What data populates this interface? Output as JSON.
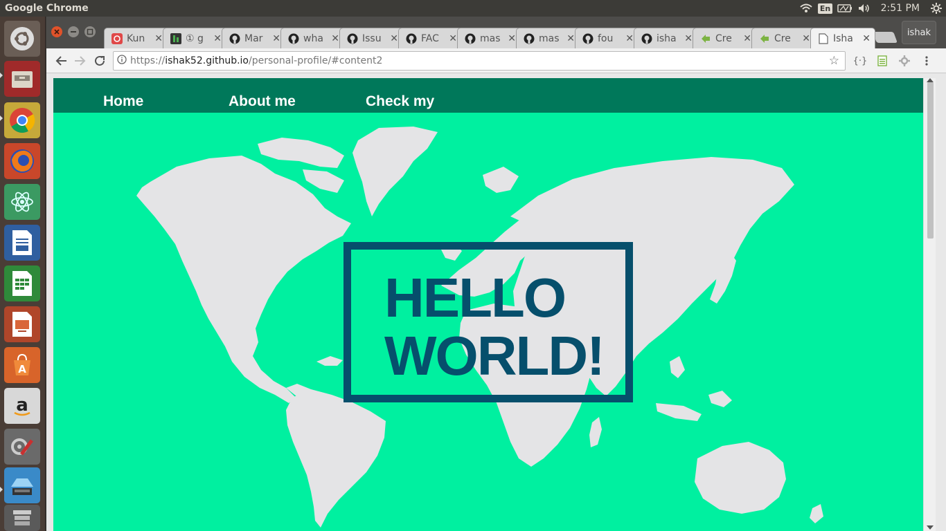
{
  "system": {
    "app_title": "Google Chrome",
    "keyboard_lang": "En",
    "clock": "2:51 PM"
  },
  "launcher": {
    "apps": [
      "ubuntu-dash",
      "files",
      "chrome",
      "firefox",
      "atom",
      "libreoffice-writer",
      "libreoffice-calc",
      "libreoffice-impress",
      "software-center",
      "amazon",
      "system-settings",
      "workspace-switcher",
      "trash"
    ]
  },
  "browser": {
    "tabs": [
      {
        "label": "Kun",
        "icon": "red-logo-icon"
      },
      {
        "label": "① g",
        "icon": "green-square-icon"
      },
      {
        "label": "Mar",
        "icon": "github-icon"
      },
      {
        "label": "wha",
        "icon": "github-icon"
      },
      {
        "label": "Issu",
        "icon": "github-icon"
      },
      {
        "label": "FAC",
        "icon": "github-icon"
      },
      {
        "label": "mas",
        "icon": "github-icon"
      },
      {
        "label": "mas",
        "icon": "github-icon"
      },
      {
        "label": "fou",
        "icon": "github-icon"
      },
      {
        "label": "isha",
        "icon": "github-icon"
      },
      {
        "label": "Cre",
        "icon": "green-arrow-icon"
      },
      {
        "label": "Cre",
        "icon": "green-arrow-icon"
      },
      {
        "label": "Isha",
        "icon": "document-icon",
        "active": true
      }
    ],
    "profile_name": "ishak",
    "url": {
      "scheme": "https://",
      "host": "ishak52.github.io",
      "path": "/personal-profile/#content2"
    }
  },
  "page": {
    "nav": [
      "Home",
      "About me",
      "Check my"
    ],
    "hero_text": "HELLO\nWORLD!"
  },
  "colors": {
    "page_bg": "#00f0a0",
    "nav_bg": "#00785a",
    "continents": "#e4e4e6",
    "hero": "#064f6c"
  }
}
